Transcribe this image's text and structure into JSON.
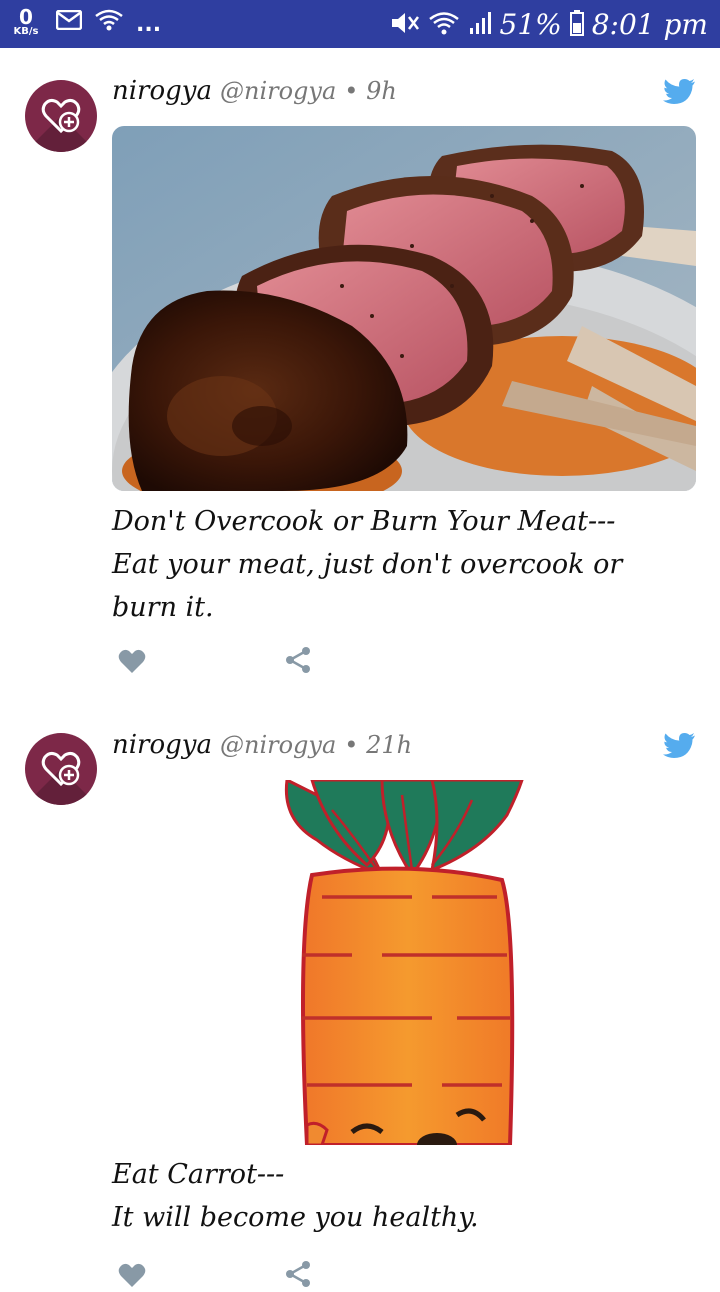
{
  "status_bar": {
    "speed_value": "0",
    "speed_unit": "KB/s",
    "more": "...",
    "battery_percent": "51%",
    "time": "8:01 pm"
  },
  "posts": [
    {
      "name": "nirogya",
      "handle": "@nirogya",
      "time": "• 9h",
      "caption_line1": "Don't Overcook or Burn Your Meat---",
      "caption_line2": "Eat your meat, just don't overcook or",
      "caption_line3": "burn it.",
      "image_icon": "lamb-chops-photo"
    },
    {
      "name": "nirogya",
      "handle": "@nirogya",
      "time": "• 21h",
      "caption_line1": "Eat Carrot---",
      "caption_line2": "It will become you healthy.",
      "image_icon": "carrot-illustration"
    }
  ],
  "colors": {
    "status_bar": "#2f3ea0",
    "avatar": "#7d2848",
    "twitter_blue": "#55acee",
    "action_gray": "#8899a6"
  }
}
